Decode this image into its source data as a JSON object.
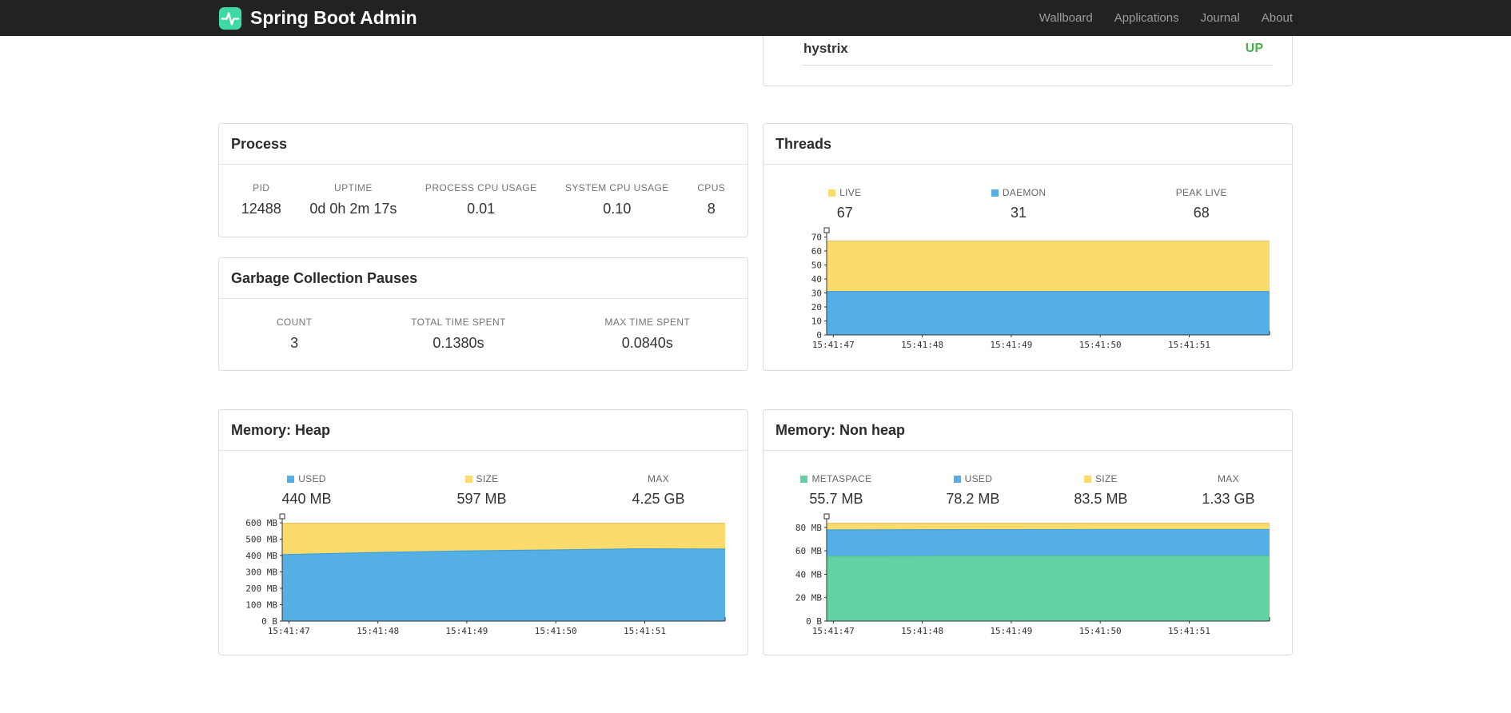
{
  "navbar": {
    "brand": "Spring Boot Admin",
    "links": [
      {
        "label": "Wallboard"
      },
      {
        "label": "Applications"
      },
      {
        "label": "Journal"
      },
      {
        "label": "About"
      }
    ]
  },
  "colors": {
    "accent_teal": "#3ed9a4",
    "status_up": "#4cae4c",
    "series_yellow": "#fbdb6b",
    "series_blue": "#54b0e4",
    "series_green": "#62d2a2"
  },
  "health_panel": {
    "row": {
      "name": "hystrix",
      "status": "UP"
    }
  },
  "process_panel": {
    "title": "Process",
    "metrics": [
      {
        "label": "PID",
        "value": "12488"
      },
      {
        "label": "UPTIME",
        "value": "0d 0h 2m 17s"
      },
      {
        "label": "PROCESS CPU USAGE",
        "value": "0.01"
      },
      {
        "label": "SYSTEM CPU USAGE",
        "value": "0.10"
      },
      {
        "label": "CPUS",
        "value": "8"
      }
    ]
  },
  "gc_panel": {
    "title": "Garbage Collection Pauses",
    "metrics": [
      {
        "label": "COUNT",
        "value": "3"
      },
      {
        "label": "TOTAL TIME SPENT",
        "value": "0.1380s"
      },
      {
        "label": "MAX TIME SPENT",
        "value": "0.0840s"
      }
    ]
  },
  "threads_panel": {
    "title": "Threads",
    "legend": [
      {
        "swatch": "#fbdb6b",
        "label": "LIVE",
        "value": "67"
      },
      {
        "swatch": "#54b0e4",
        "label": "DAEMON",
        "value": "31"
      },
      {
        "swatch": null,
        "label": "PEAK LIVE",
        "value": "68"
      }
    ]
  },
  "heap_panel": {
    "title": "Memory: Heap",
    "legend": [
      {
        "swatch": "#54b0e4",
        "label": "USED",
        "value": "440 MB"
      },
      {
        "swatch": "#fbdb6b",
        "label": "SIZE",
        "value": "597 MB"
      },
      {
        "swatch": null,
        "label": "MAX",
        "value": "4.25 GB"
      }
    ]
  },
  "nonheap_panel": {
    "title": "Memory: Non heap",
    "legend": [
      {
        "swatch": "#62d2a2",
        "label": "METASPACE",
        "value": "55.7 MB"
      },
      {
        "swatch": "#54b0e4",
        "label": "USED",
        "value": "78.2 MB"
      },
      {
        "swatch": "#fbdb6b",
        "label": "SIZE",
        "value": "83.5 MB"
      },
      {
        "swatch": null,
        "label": "MAX",
        "value": "1.33 GB"
      }
    ]
  },
  "chart_data": [
    {
      "id": "threads",
      "type": "area",
      "stacked": true,
      "title": "Threads",
      "x_labels": [
        "15:41:47",
        "15:41:48",
        "15:41:49",
        "15:41:50",
        "15:41:51"
      ],
      "y_max": 72,
      "y_ticks": [
        {
          "v": 0,
          "label": "0"
        },
        {
          "v": 10,
          "label": "10"
        },
        {
          "v": 20,
          "label": "20"
        },
        {
          "v": 30,
          "label": "30"
        },
        {
          "v": 40,
          "label": "40"
        },
        {
          "v": 50,
          "label": "50"
        },
        {
          "v": 60,
          "label": "60"
        },
        {
          "v": 70,
          "label": "70"
        }
      ],
      "series": [
        {
          "name": "LIVE",
          "color": "#fbdb6b",
          "line": "#e6c35c",
          "values": [
            67,
            67,
            67,
            67,
            67,
            67
          ]
        },
        {
          "name": "DAEMON",
          "color": "#54b0e4",
          "line": "#3f9fd8",
          "values": [
            31,
            31,
            31,
            31,
            31,
            31
          ]
        }
      ]
    },
    {
      "id": "memory-heap",
      "type": "area",
      "stacked": false,
      "title": "Memory: Heap",
      "x_labels": [
        "15:41:47",
        "15:41:48",
        "15:41:49",
        "15:41:50",
        "15:41:51"
      ],
      "y_max": 615,
      "y_ticks": [
        {
          "v": 0,
          "label": "0 B"
        },
        {
          "v": 100,
          "label": "100 MB"
        },
        {
          "v": 200,
          "label": "200 MB"
        },
        {
          "v": 300,
          "label": "300 MB"
        },
        {
          "v": 400,
          "label": "400 MB"
        },
        {
          "v": 500,
          "label": "500 MB"
        },
        {
          "v": 600,
          "label": "600 MB"
        }
      ],
      "series": [
        {
          "name": "SIZE",
          "color": "#fbdb6b",
          "line": "#e6c35c",
          "values": [
            597,
            597,
            597,
            597,
            597,
            597
          ]
        },
        {
          "name": "USED",
          "color": "#54b0e4",
          "line": "#3f9fd8",
          "values": [
            406,
            418,
            428,
            434,
            441,
            440
          ]
        }
      ]
    },
    {
      "id": "memory-nonheap",
      "type": "area",
      "stacked": false,
      "title": "Memory: Non heap",
      "x_labels": [
        "15:41:47",
        "15:41:48",
        "15:41:49",
        "15:41:50",
        "15:41:51"
      ],
      "y_max": 86,
      "y_ticks": [
        {
          "v": 0,
          "label": "0 B"
        },
        {
          "v": 20,
          "label": "20 MB"
        },
        {
          "v": 40,
          "label": "40 MB"
        },
        {
          "v": 60,
          "label": "60 MB"
        },
        {
          "v": 80,
          "label": "80 MB"
        }
      ],
      "series": [
        {
          "name": "SIZE",
          "color": "#fbdb6b",
          "line": "#e6c35c",
          "values": [
            83.5,
            83.5,
            83.5,
            83.5,
            83.5,
            83.5
          ]
        },
        {
          "name": "USED",
          "color": "#54b0e4",
          "line": "#3f9fd8",
          "values": [
            77.8,
            78.0,
            78.1,
            78.2,
            78.2,
            78.2
          ]
        },
        {
          "name": "METASPACE",
          "color": "#62d2a2",
          "line": "#4fc096",
          "values": [
            55.4,
            55.5,
            55.6,
            55.7,
            55.7,
            55.7
          ]
        }
      ]
    }
  ]
}
